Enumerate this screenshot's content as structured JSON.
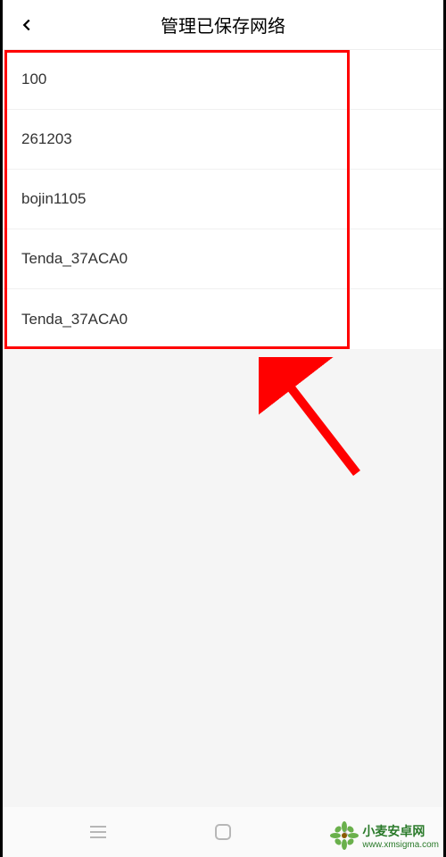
{
  "header": {
    "title": "管理已保存网络"
  },
  "networks": [
    {
      "name": "100"
    },
    {
      "name": "261203"
    },
    {
      "name": "bojin1105"
    },
    {
      "name": "Tenda_37ACA0"
    },
    {
      "name": "Tenda_37ACA0"
    }
  ],
  "watermark": {
    "title": "小麦安卓网",
    "url": "www.xmsigma.com"
  }
}
